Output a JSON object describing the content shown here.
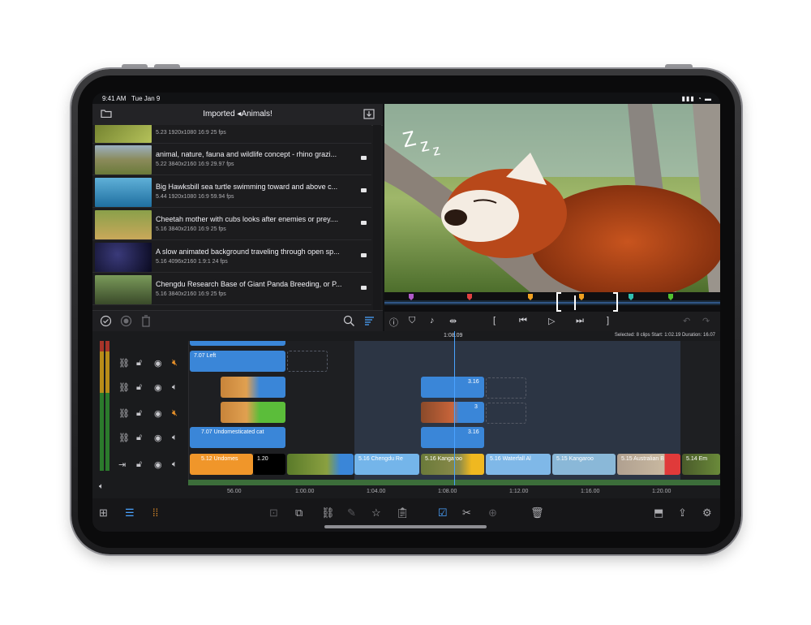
{
  "status": {
    "time": "9:41 AM",
    "date": "Tue Jan 9",
    "right": "▮▮▮ ◔ ▬"
  },
  "library": {
    "title": "Imported ◂Animals!",
    "clips": [
      {
        "title": "",
        "meta": "5.23  1920x1080  16:9  25 fps",
        "color": "#8a9a3a"
      },
      {
        "title": "animal, nature, fauna and wildlife concept - rhino grazi...",
        "meta": "5.22  3840x2160  16:9  29.97 fps",
        "color": "#7a8a55"
      },
      {
        "title": "Big Hawksbill sea turtle swimming toward and above c...",
        "meta": "5.44  1920x1080  16:9  59.94 fps",
        "color": "#2f7fb0"
      },
      {
        "title": "Cheetah mother with cubs looks after enemies or prey....",
        "meta": "5.16  3840x2160  16:9  25 fps",
        "color": "#b89a4a"
      },
      {
        "title": "A slow animated background traveling through open sp...",
        "meta": "5.16  4096x2160  1.9:1  24 fps",
        "color": "#1a1a3a"
      },
      {
        "title": "Chengdu Research Base of Giant Panda Breeding, or P...",
        "meta": "5.16  3840x2160  16:9  25 fps",
        "color": "#4a6a3a"
      }
    ]
  },
  "timeline": {
    "timecode": "1:08.09",
    "info": "Selected: 8 clips  Start: 1:02.19  Duration: 16.07",
    "clips": {
      "left_title": "7.07  Left",
      "tiger_badge": "",
      "red1": "3.16",
      "red2": "3",
      "red3": "3.16",
      "cat_title": "7.07  Undomesticated cat",
      "undomes": "5.12  Undomes",
      "audio": "1.20",
      "chengdu": "5.16  Chengdu Re",
      "kangaroo": "5.16  Kangaroo",
      "waterfall": "5.16  Waterfall Al",
      "kangaroo2": "5.15  Kangaroo",
      "australian": "5.15  Australian B",
      "em": "5.14  Em"
    },
    "ruler": [
      "56.00",
      "1:00.00",
      "1:04.00",
      "1:08.00",
      "1:12.00",
      "1:16.00",
      "1:20.00"
    ]
  }
}
